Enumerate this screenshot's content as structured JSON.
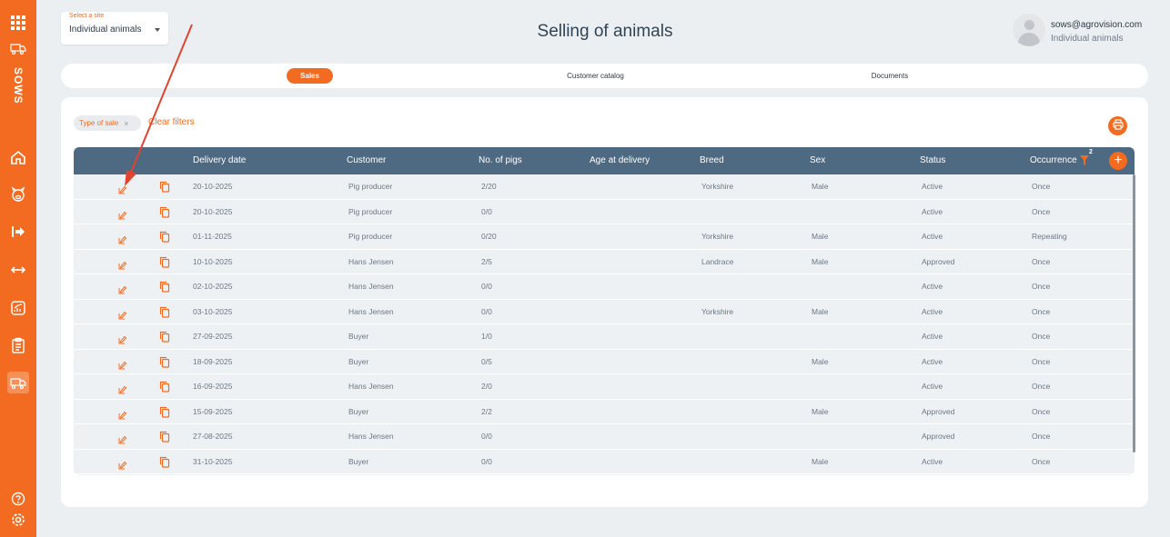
{
  "sidebar": {
    "app_label": "SOWS",
    "icons": [
      "apps-grid-icon",
      "truck-small-icon",
      "home-icon",
      "pig-icon",
      "login-arrow-icon",
      "transfer-arrows-icon",
      "chart-icon",
      "clipboard-icon",
      "delivery-truck-icon",
      "help-icon",
      "settings-icon"
    ]
  },
  "header": {
    "site_select_label": "Select a site",
    "site_select_value": "Individual animals",
    "page_title": "Selling of animals",
    "user_email": "sows@agrovision.com",
    "user_site": "Individual animals"
  },
  "tabs": [
    {
      "label": "Sales",
      "active": true
    },
    {
      "label": "Customer catalog",
      "active": false
    },
    {
      "label": "Documents",
      "active": false
    }
  ],
  "filters": {
    "chip_label": "Type of sale",
    "chip_remove": "×",
    "clear_label": "Clear filters"
  },
  "table": {
    "columns": [
      "Delivery date",
      "Customer",
      "No. of pigs",
      "Age at delivery",
      "Breed",
      "Sex",
      "Status",
      "Occurrence"
    ],
    "occurrence_filter_count": "2",
    "add_label": "+",
    "rows": [
      {
        "date": "20-10-2025",
        "customer": "Pig producer",
        "pigs": "2/20",
        "age": "",
        "breed": "Yorkshire",
        "sex": "Male",
        "status": "Active",
        "occurrence": "Once"
      },
      {
        "date": "20-10-2025",
        "customer": "Pig producer",
        "pigs": "0/0",
        "age": "",
        "breed": "",
        "sex": "",
        "status": "Active",
        "occurrence": "Once"
      },
      {
        "date": "01-11-2025",
        "customer": "Pig producer",
        "pigs": "0/20",
        "age": "",
        "breed": "Yorkshire",
        "sex": "Male",
        "status": "Active",
        "occurrence": "Repeating"
      },
      {
        "date": "10-10-2025",
        "customer": "Hans Jensen",
        "pigs": "2/5",
        "age": "",
        "breed": "Landrace",
        "sex": "Male",
        "status": "Approved",
        "occurrence": "Once"
      },
      {
        "date": "02-10-2025",
        "customer": "Hans Jensen",
        "pigs": "0/0",
        "age": "",
        "breed": "",
        "sex": "",
        "status": "Active",
        "occurrence": "Once"
      },
      {
        "date": "03-10-2025",
        "customer": "Hans Jensen",
        "pigs": "0/0",
        "age": "",
        "breed": "Yorkshire",
        "sex": "Male",
        "status": "Active",
        "occurrence": "Once"
      },
      {
        "date": "27-09-2025",
        "customer": "Buyer",
        "pigs": "1/0",
        "age": "",
        "breed": "",
        "sex": "",
        "status": "Active",
        "occurrence": "Once"
      },
      {
        "date": "18-09-2025",
        "customer": "Buyer",
        "pigs": "0/5",
        "age": "",
        "breed": "",
        "sex": "Male",
        "status": "Active",
        "occurrence": "Once"
      },
      {
        "date": "16-09-2025",
        "customer": "Hans Jensen",
        "pigs": "2/0",
        "age": "",
        "breed": "",
        "sex": "",
        "status": "Active",
        "occurrence": "Once"
      },
      {
        "date": "15-09-2025",
        "customer": "Buyer",
        "pigs": "2/2",
        "age": "",
        "breed": "",
        "sex": "Male",
        "status": "Approved",
        "occurrence": "Once"
      },
      {
        "date": "27-08-2025",
        "customer": "Hans Jensen",
        "pigs": "0/0",
        "age": "",
        "breed": "",
        "sex": "",
        "status": "Approved",
        "occurrence": "Once"
      },
      {
        "date": "31-10-2025",
        "customer": "Buyer",
        "pigs": "0/0",
        "age": "",
        "breed": "",
        "sex": "Male",
        "status": "Active",
        "occurrence": "Once"
      }
    ]
  },
  "colors": {
    "accent": "#f26b21",
    "table_header": "#4d6a82",
    "row_bg": "#eef1f4"
  }
}
